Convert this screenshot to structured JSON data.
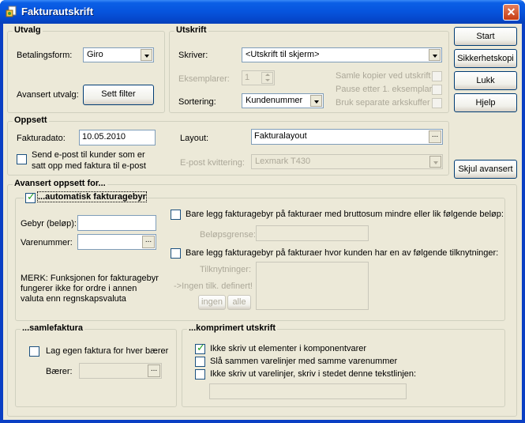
{
  "window": {
    "title": "Fakturautskrift",
    "icon": "invoice-app-icon"
  },
  "utvalg": {
    "legend": "Utvalg",
    "betalingsform_label": "Betalingsform:",
    "betalingsform_value": "Giro",
    "avansert_label": "Avansert utvalg:",
    "sett_filter_label": "Sett filter"
  },
  "utskrift": {
    "legend": "Utskrift",
    "skriver_label": "Skriver:",
    "skriver_value": "<Utskrift til skjerm>",
    "eksemplarer_label": "Eksemplarer:",
    "eksemplarer_value": "1",
    "sortering_label": "Sortering:",
    "sortering_value": "Kundenummer",
    "samle_kopier": "Samle kopier ved utskrift",
    "pause_etter": "Pause etter 1. eksemplar",
    "bruk_separate": "Bruk separate arkskuffer"
  },
  "buttons": {
    "start": "Start",
    "sikkerhetskopi": "Sikkerhetskopi",
    "lukk": "Lukk",
    "hjelp": "Hjelp",
    "skjul_avansert": "Skjul avansert"
  },
  "oppsett": {
    "legend": "Oppsett",
    "fakturadato_label": "Fakturadato:",
    "fakturadato_value": "10.05.2010",
    "layout_label": "Layout:",
    "layout_value": "Fakturalayout",
    "send_epost_line1": "Send e-post til kunder som er",
    "send_epost_line2": "satt opp med faktura til e-post",
    "epost_kvittering_label": "E-post kvittering:",
    "epost_kvittering_value": "Lexmark T430"
  },
  "avansert": {
    "legend": "Avansert oppsett for...",
    "auto_gebyr_label": "...automatisk fakturagebyr",
    "gebyr_label": "Gebyr (beløp):",
    "gebyr_value": "",
    "varenummer_label": "Varenummer:",
    "varenummer_value": "",
    "merk_line1": "MERK: Funksjonen for fakturagebyr",
    "merk_line2": "fungerer ikke for ordre i annen",
    "merk_line3": "valuta enn regnskapsvaluta",
    "bare_brutto": "Bare legg fakturagebyr på fakturaer med bruttosum mindre eller lik følgende beløp:",
    "belopsgrense_label": "Beløpsgrense:",
    "bare_tilknytning": "Bare legg fakturagebyr på fakturaer hvor kunden har en av følgende tilknytninger:",
    "tilknytninger_label": "Tilknytninger:",
    "ingen_tilk": "->Ingen tilk. definert!",
    "ingen_btn": "ingen",
    "alle_btn": "alle"
  },
  "samlefaktura": {
    "legend": "...samlefaktura",
    "egen_faktura": "Lag egen faktura for hver bærer",
    "baerer_label": "Bærer:"
  },
  "komprimert": {
    "legend": "...komprimert utskrift",
    "ikke_skriv_elementer": "Ikke skriv ut elementer i komponentvarer",
    "sla_sammen": "Slå sammen varelinjer med samme varenummer",
    "ikke_skriv_varelinjer": "Ikke skriv ut varelinjer, skriv i stedet denne tekstlinjen:"
  }
}
